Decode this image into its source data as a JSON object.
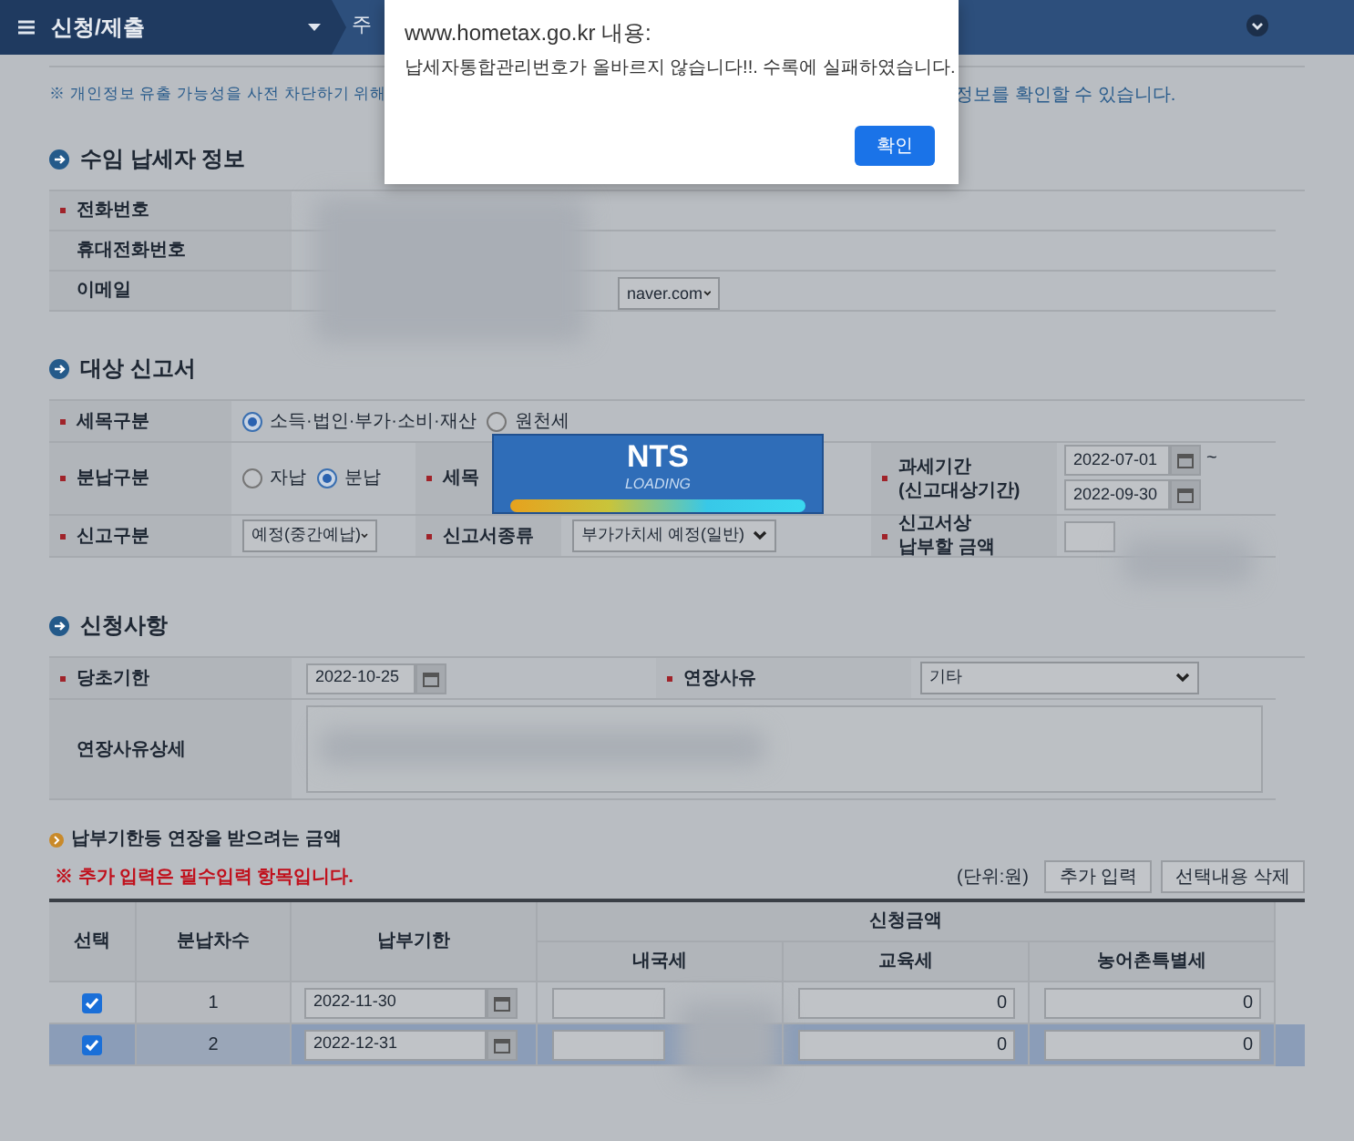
{
  "nav": {
    "menu_title": "신청/제출",
    "next_tab": "주"
  },
  "notice": [
    "※ 개인정보 유출 가능성을 사전 차단하기 위해",
    "정보를 확인할 수 있습니다."
  ],
  "taxpayer": {
    "title": "수임 납세자 정보",
    "fields": [
      {
        "label": "전화번호",
        "required": true
      },
      {
        "label": "휴대전화번호",
        "required": false
      },
      {
        "label": "이메일",
        "required": false,
        "domain": "naver.com"
      }
    ]
  },
  "target": {
    "title": "대상 신고서",
    "tax_type": {
      "label": "세목구분",
      "required": true,
      "options": [
        {
          "label": "소득·법인·부가·소비·재산",
          "selected": true
        },
        {
          "label": "원천세",
          "selected": false
        }
      ]
    },
    "installment": {
      "label": "분납구분",
      "required": true,
      "options": [
        {
          "label": "자납",
          "selected": false
        },
        {
          "label": "분납",
          "selected": true
        }
      ]
    },
    "tax_item": {
      "label": "세목",
      "required": true
    },
    "period": {
      "label": "과세기간",
      "sublabel": "(신고대상기간)",
      "required": true,
      "from": "2022-07-01",
      "to": "2022-09-30",
      "separator": "~"
    },
    "report_type": {
      "label": "신고구분",
      "required": true,
      "value": "예정(중간예납)"
    },
    "form_type": {
      "label": "신고서종류",
      "required": true,
      "value": "부가가치세 예정(일반)"
    },
    "amount": {
      "label": "신고서상",
      "sublabel": "납부할 금액",
      "required": true
    }
  },
  "request": {
    "title": "신청사항",
    "original_due": {
      "label": "당초기한",
      "required": true,
      "value": "2022-10-25"
    },
    "reason": {
      "label": "연장사유",
      "required": true,
      "value": "기타"
    },
    "detail": {
      "label": "연장사유상세",
      "required": false
    }
  },
  "amounts": {
    "title": "납부기한등 연장을 받으려는 금액",
    "warning": "※ 추가 입력은 필수입력 항목입니다.",
    "unit": "(단위:원)",
    "buttons": [
      "추가 입력",
      "선택내용 삭제"
    ],
    "columns": [
      "선택",
      "분납차수",
      "납부기한",
      "신청금액",
      "내국세",
      "교육세",
      "농어촌특별세"
    ],
    "rows": [
      {
        "checked": true,
        "selected": false,
        "number": "1",
        "due": "2022-11-30",
        "education": "0",
        "rural": "0"
      },
      {
        "checked": true,
        "selected": true,
        "number": "2",
        "due": "2022-12-31",
        "education": "0",
        "rural": "0"
      }
    ]
  },
  "loading": {
    "title": "NTS",
    "subtitle": "LOADING"
  },
  "dialog": {
    "origin": "www.hometax.go.kr 내용:",
    "message": "납세자통합관리번호가 올바르지 않습니다!!. 수록에 실패하였습니다.",
    "button": "확인"
  }
}
